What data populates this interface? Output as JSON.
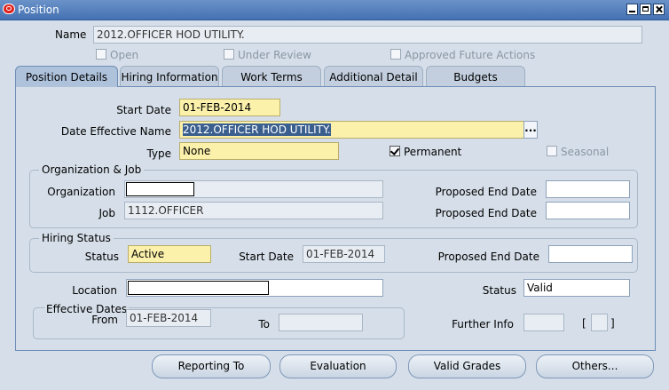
{
  "window": {
    "title": "Position"
  },
  "name": {
    "label": "Name",
    "value": "2012.OFFICER HOD UTILITY."
  },
  "flags": {
    "open": "Open",
    "under_review": "Under Review",
    "approved": "Approved Future Actions"
  },
  "tabs": [
    {
      "label": "Position Details"
    },
    {
      "label": "Hiring Information"
    },
    {
      "label": "Work Terms"
    },
    {
      "label": "Additional Detail"
    },
    {
      "label": "Budgets"
    }
  ],
  "details": {
    "start_date_label": "Start Date",
    "start_date": "01-FEB-2014",
    "date_eff_name_label": "Date Effective Name",
    "date_eff_name": "2012.OFFICER HOD UTILITY.",
    "lov_glyph": "...",
    "type_label": "Type",
    "type": "None",
    "permanent": "Permanent",
    "seasonal": "Seasonal"
  },
  "org_job": {
    "title": "Organization & Job",
    "org_label": "Organization",
    "org_value": "",
    "job_label": "Job",
    "job_value": "1112.OFFICER",
    "ped_label_1": "Proposed End Date",
    "ped_value_1": "",
    "ped_label_2": "Proposed End Date",
    "ped_value_2": ""
  },
  "hiring": {
    "title": "Hiring Status",
    "status_label": "Status",
    "status": "Active",
    "start_label": "Start Date",
    "start": "01-FEB-2014",
    "ped_label": "Proposed End Date",
    "ped_value": ""
  },
  "location": {
    "label": "Location",
    "value": "",
    "status_label": "Status",
    "status": "Valid"
  },
  "effective": {
    "title": "Effective Dates",
    "from_label": "From",
    "from": "01-FEB-2014",
    "to_label": "To",
    "to": "",
    "further_label": "Further Info",
    "further": "",
    "dff_open": "[",
    "dff_close": "]"
  },
  "buttons": {
    "reporting": "Reporting To",
    "evaluation": "Evaluation",
    "grades": "Valid Grades",
    "others": "Others..."
  }
}
